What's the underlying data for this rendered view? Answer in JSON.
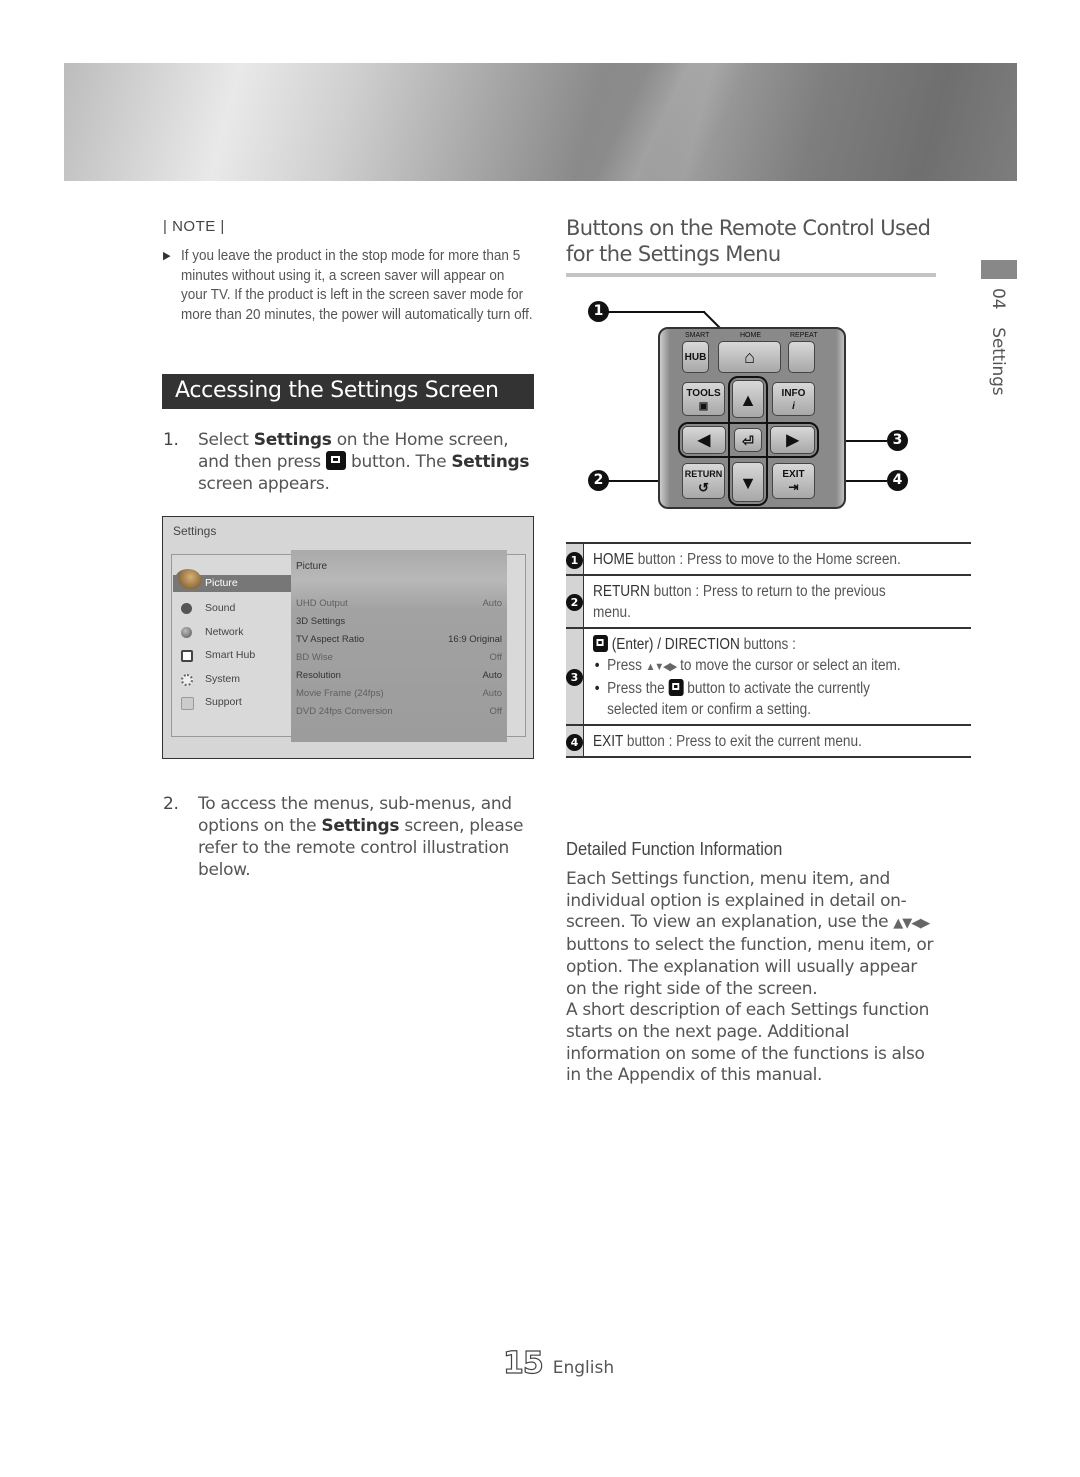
{
  "banner": {
    "icon": "decorative-banner"
  },
  "note": {
    "title": "| NOTE |",
    "bullet_icon": "triangle-right",
    "text": "If you leave the product in the stop mode for more than 5 minutes without using it, a screen saver will appear on your TV. If the product is left in the screen saver mode for more than 20 minutes, the power will automatically turn off."
  },
  "section": {
    "title": "Accessing the Settings Screen"
  },
  "steps": [
    {
      "num": "1.",
      "pre": "Select ",
      "bold1": "Settings",
      "mid": " on the Home screen, and then press ",
      "icon": "enter-icon",
      "post": " button. The ",
      "bold2": "Settings",
      "end": " screen appears."
    },
    {
      "num": "2.",
      "pre": "To access the menus, sub-menus, and options on the ",
      "bold1": "Settings",
      "end": " screen, please refer to the remote control illustration below."
    }
  ],
  "settings_screen": {
    "title": "Settings",
    "menu": [
      {
        "label": "Picture",
        "icon": "picture-icon",
        "active": true
      },
      {
        "label": "Sound",
        "icon": "sound-icon"
      },
      {
        "label": "Network",
        "icon": "network-icon"
      },
      {
        "label": "Smart Hub",
        "icon": "smart-hub-icon"
      },
      {
        "label": "System",
        "icon": "system-icon"
      },
      {
        "label": "Support",
        "icon": "support-icon"
      }
    ],
    "panel_title": "Picture",
    "rows": [
      {
        "label": "UHD Output",
        "value": "Auto",
        "dim": true
      },
      {
        "label": "3D Settings",
        "value": ""
      },
      {
        "label": "TV Aspect Ratio",
        "value": "16:9 Original"
      },
      {
        "label": "BD Wise",
        "value": "Off",
        "dim": true
      },
      {
        "label": "Resolution",
        "value": "Auto"
      },
      {
        "label": "Movie Frame (24fps)",
        "value": "Auto",
        "dim": true
      },
      {
        "label": "DVD 24fps Conversion",
        "value": "Off",
        "dim": true
      }
    ]
  },
  "remote_section": {
    "title": "Buttons on the Remote Control Used for the Settings Menu",
    "callouts": [
      "1",
      "2",
      "3",
      "4"
    ],
    "remote": {
      "labels": {
        "smart": "SMART",
        "home": "HOME",
        "repeat": "REPEAT"
      },
      "hub": "HUB",
      "tools": "TOOLS",
      "info": "INFO",
      "info_glyph": "i",
      "return": "RETURN",
      "return_glyph": "↺",
      "exit": "EXIT",
      "exit_glyph": "⇥",
      "home_glyph": "⌂",
      "up": "▲",
      "down": "▼",
      "left": "◀",
      "right": "▶",
      "enter_glyph": "⏎"
    },
    "table": [
      {
        "num": "1",
        "bold": "HOME",
        "text": " button : Press to move to the Home screen."
      },
      {
        "num": "2",
        "bold": "RETURN",
        "text": " button : Press to return to the previous menu."
      },
      {
        "num": "3",
        "bold": "(Enter) / DIRECTION",
        "text": " buttons :",
        "bullets": [
          {
            "pre": "Press ",
            "arrows": "▲▼◀▶",
            "post": " to move the cursor or select an item."
          },
          {
            "pre": "Press the ",
            "post": " button to activate the currently selected item or confirm a setting."
          }
        ]
      },
      {
        "num": "4",
        "bold": "EXIT",
        "text": " button : Press to exit the current menu."
      }
    ]
  },
  "detail": {
    "title": "Detailed Function Information",
    "p1_pre": "Each Settings function, menu item, and individual option is explained in detail on-screen. To view an explanation, use the ",
    "arrows": "▲▼◀▶",
    "p1_post": " buttons to select the function, menu item, or option. The explanation will usually appear on the right side of the screen.",
    "p2": "A short description of each Settings function starts on the next page. Additional information on some of the functions is also in the Appendix of this manual."
  },
  "side_tab": {
    "chapter": "04",
    "label": "Settings"
  },
  "footer": {
    "page": "15",
    "language": "English"
  }
}
